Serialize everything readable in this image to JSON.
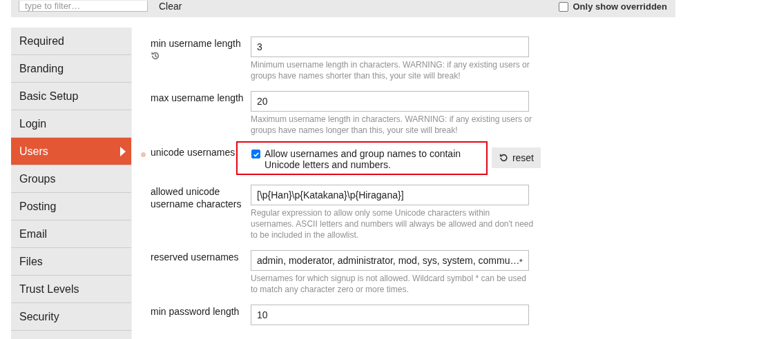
{
  "filter": {
    "placeholder": "type to filter…",
    "clear": "Clear",
    "only_overridden": {
      "label": "Only show overridden",
      "checked": false
    }
  },
  "sidebar": {
    "items": [
      {
        "label": "Required",
        "selected": false
      },
      {
        "label": "Branding",
        "selected": false
      },
      {
        "label": "Basic Setup",
        "selected": false
      },
      {
        "label": "Login",
        "selected": false
      },
      {
        "label": "Users",
        "selected": true
      },
      {
        "label": "Groups",
        "selected": false
      },
      {
        "label": "Posting",
        "selected": false
      },
      {
        "label": "Email",
        "selected": false
      },
      {
        "label": "Files",
        "selected": false
      },
      {
        "label": "Trust Levels",
        "selected": false
      },
      {
        "label": "Security",
        "selected": false
      }
    ]
  },
  "settings": [
    {
      "kind": "text",
      "label": "min username length",
      "history": true,
      "overridden": false,
      "highlighted": false,
      "value": "3",
      "description": "Minimum username length in characters. WARNING: if any existing users or groups have names shorter than this, your site will break!"
    },
    {
      "kind": "text",
      "label": "max username length",
      "history": false,
      "overridden": false,
      "highlighted": false,
      "value": "20",
      "description": "Maximum username length in characters. WARNING: if any existing users or groups have names longer than this, your site will break!"
    },
    {
      "kind": "bool",
      "label": "unicode usernames",
      "history": false,
      "overridden": true,
      "highlighted": true,
      "checked": true,
      "description": "Allow usernames and group names to contain Unicode letters and numbers.",
      "reset": "reset"
    },
    {
      "kind": "text",
      "label": "allowed unicode username characters",
      "history": false,
      "overridden": false,
      "highlighted": false,
      "value": "[\\p{Han}\\p{Katakana}\\p{Hiragana}]",
      "description": "Regular expression to allow only some Unicode characters within usernames. ASCII letters and numbers will always be allowed and don't need to be included in the allowlist."
    },
    {
      "kind": "list",
      "label": "reserved usernames",
      "history": false,
      "overridden": false,
      "highlighted": false,
      "value": "admin, moderator, administrator, mod, sys, system, commu…",
      "description": "Usernames for which signup is not allowed. Wildcard symbol * can be used to match any character zero or more times."
    },
    {
      "kind": "text",
      "label": "min password length",
      "history": false,
      "overridden": false,
      "highlighted": false,
      "value": "10"
    }
  ]
}
